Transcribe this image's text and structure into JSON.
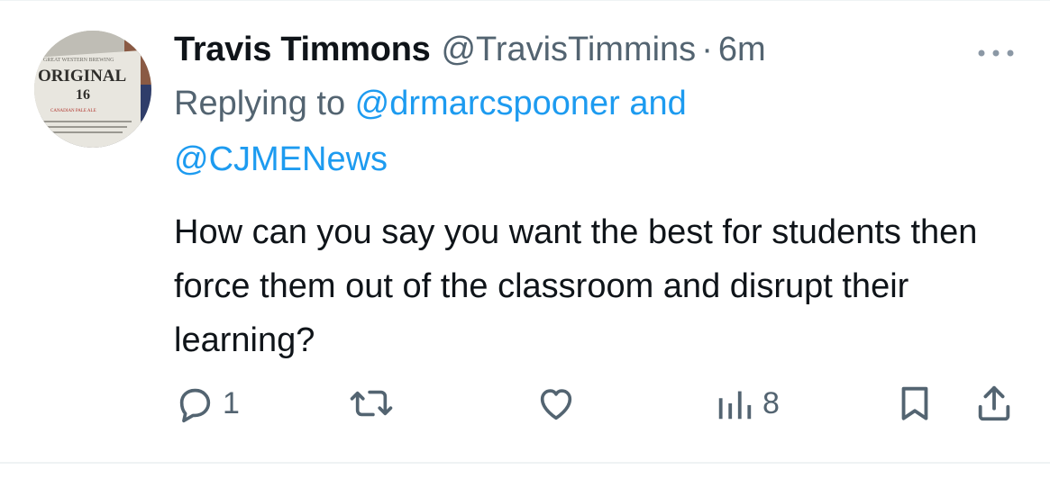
{
  "tweet": {
    "display_name": "Travis Timmons",
    "handle": "@TravisTimmins",
    "separator": "·",
    "time": "6m",
    "replying_prefix": "Replying to ",
    "mention_1": "@drmarcspooner",
    "mention_joiner": " and",
    "mention_2": "@CJMENews",
    "text": "How can you say you want the best for students then force them out of the classroom and disrupt their learning?"
  },
  "avatar": {
    "top_text": "GREAT WESTERN BREWING",
    "brand": "ORIGINAL",
    "number": "16",
    "sub_text": "CANADIAN PALE ALE"
  },
  "actions": {
    "reply_count": "1",
    "retweet_count": "",
    "like_count": "",
    "views_count": "8"
  },
  "icons": {
    "more": "more-horizontal-icon",
    "reply": "reply-bubble-icon",
    "retweet": "retweet-icon",
    "like": "heart-icon",
    "views": "views-bar-icon",
    "bookmark": "bookmark-icon",
    "share": "share-upload-icon"
  },
  "colors": {
    "text_primary": "#0f1419",
    "text_secondary": "#536471",
    "link": "#1d9bf0",
    "divider": "#eff3f4"
  }
}
